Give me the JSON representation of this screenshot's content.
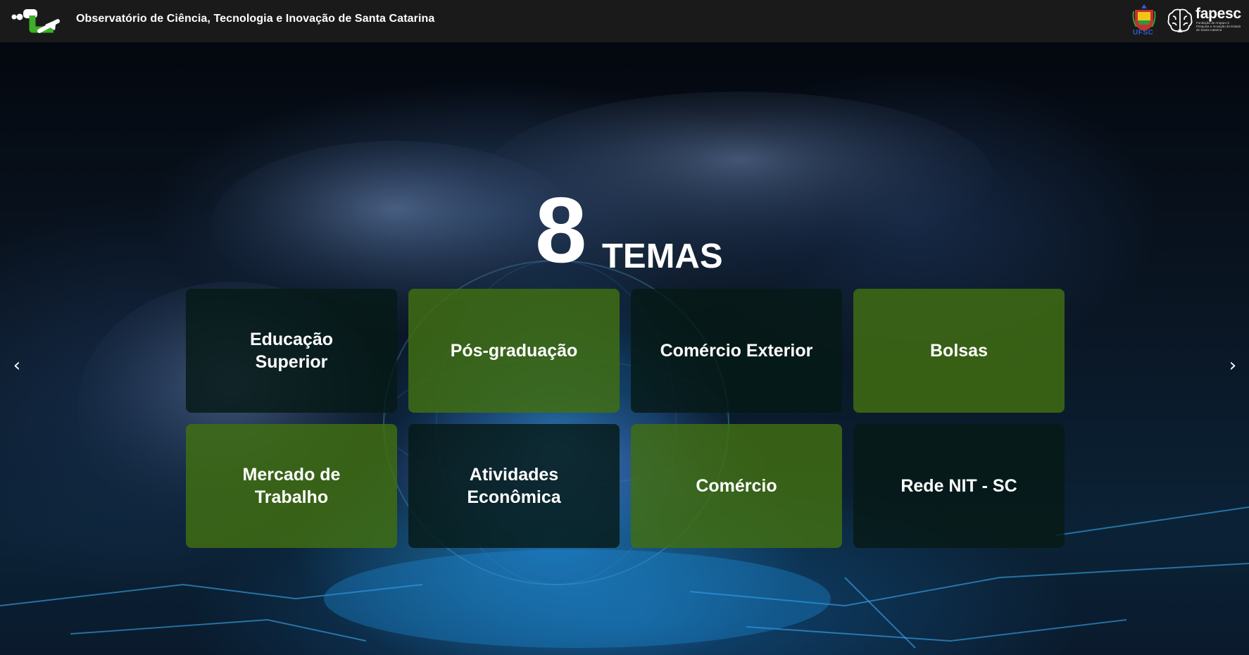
{
  "header": {
    "title": "Observatório de Ciência, Tecnologia e Inovação de Santa Catarina",
    "logo_icon": "observatorio-logo-icon",
    "partners": {
      "ufsc_text": "UFSC",
      "fapesc_text": "fapesc",
      "fapesc_subtitle": "Fundação de Amparo à Pesquisa e Inovação do Estado de Santa Catarina"
    }
  },
  "hero": {
    "count": "8",
    "label": "TEMAS"
  },
  "themes": [
    {
      "label": "Educação Superior",
      "style": "dark"
    },
    {
      "label": "Pós-graduação",
      "style": "green"
    },
    {
      "label": "Comércio Exterior",
      "style": "dark"
    },
    {
      "label": "Bolsas",
      "style": "green"
    },
    {
      "label": "Mercado de Trabalho",
      "style": "green"
    },
    {
      "label": "Atividades Econômica",
      "style": "dark"
    },
    {
      "label": "Comércio",
      "style": "green"
    },
    {
      "label": "Rede NIT - SC",
      "style": "dark"
    }
  ],
  "carousel": {
    "prev_icon": "chevron-left-icon",
    "next_icon": "chevron-right-icon",
    "prev_glyph": "‹",
    "next_glyph": "›"
  },
  "colors": {
    "header_bg": "#1a1a1b",
    "tile_green": "#406e12",
    "tile_dark": "#061a16"
  }
}
